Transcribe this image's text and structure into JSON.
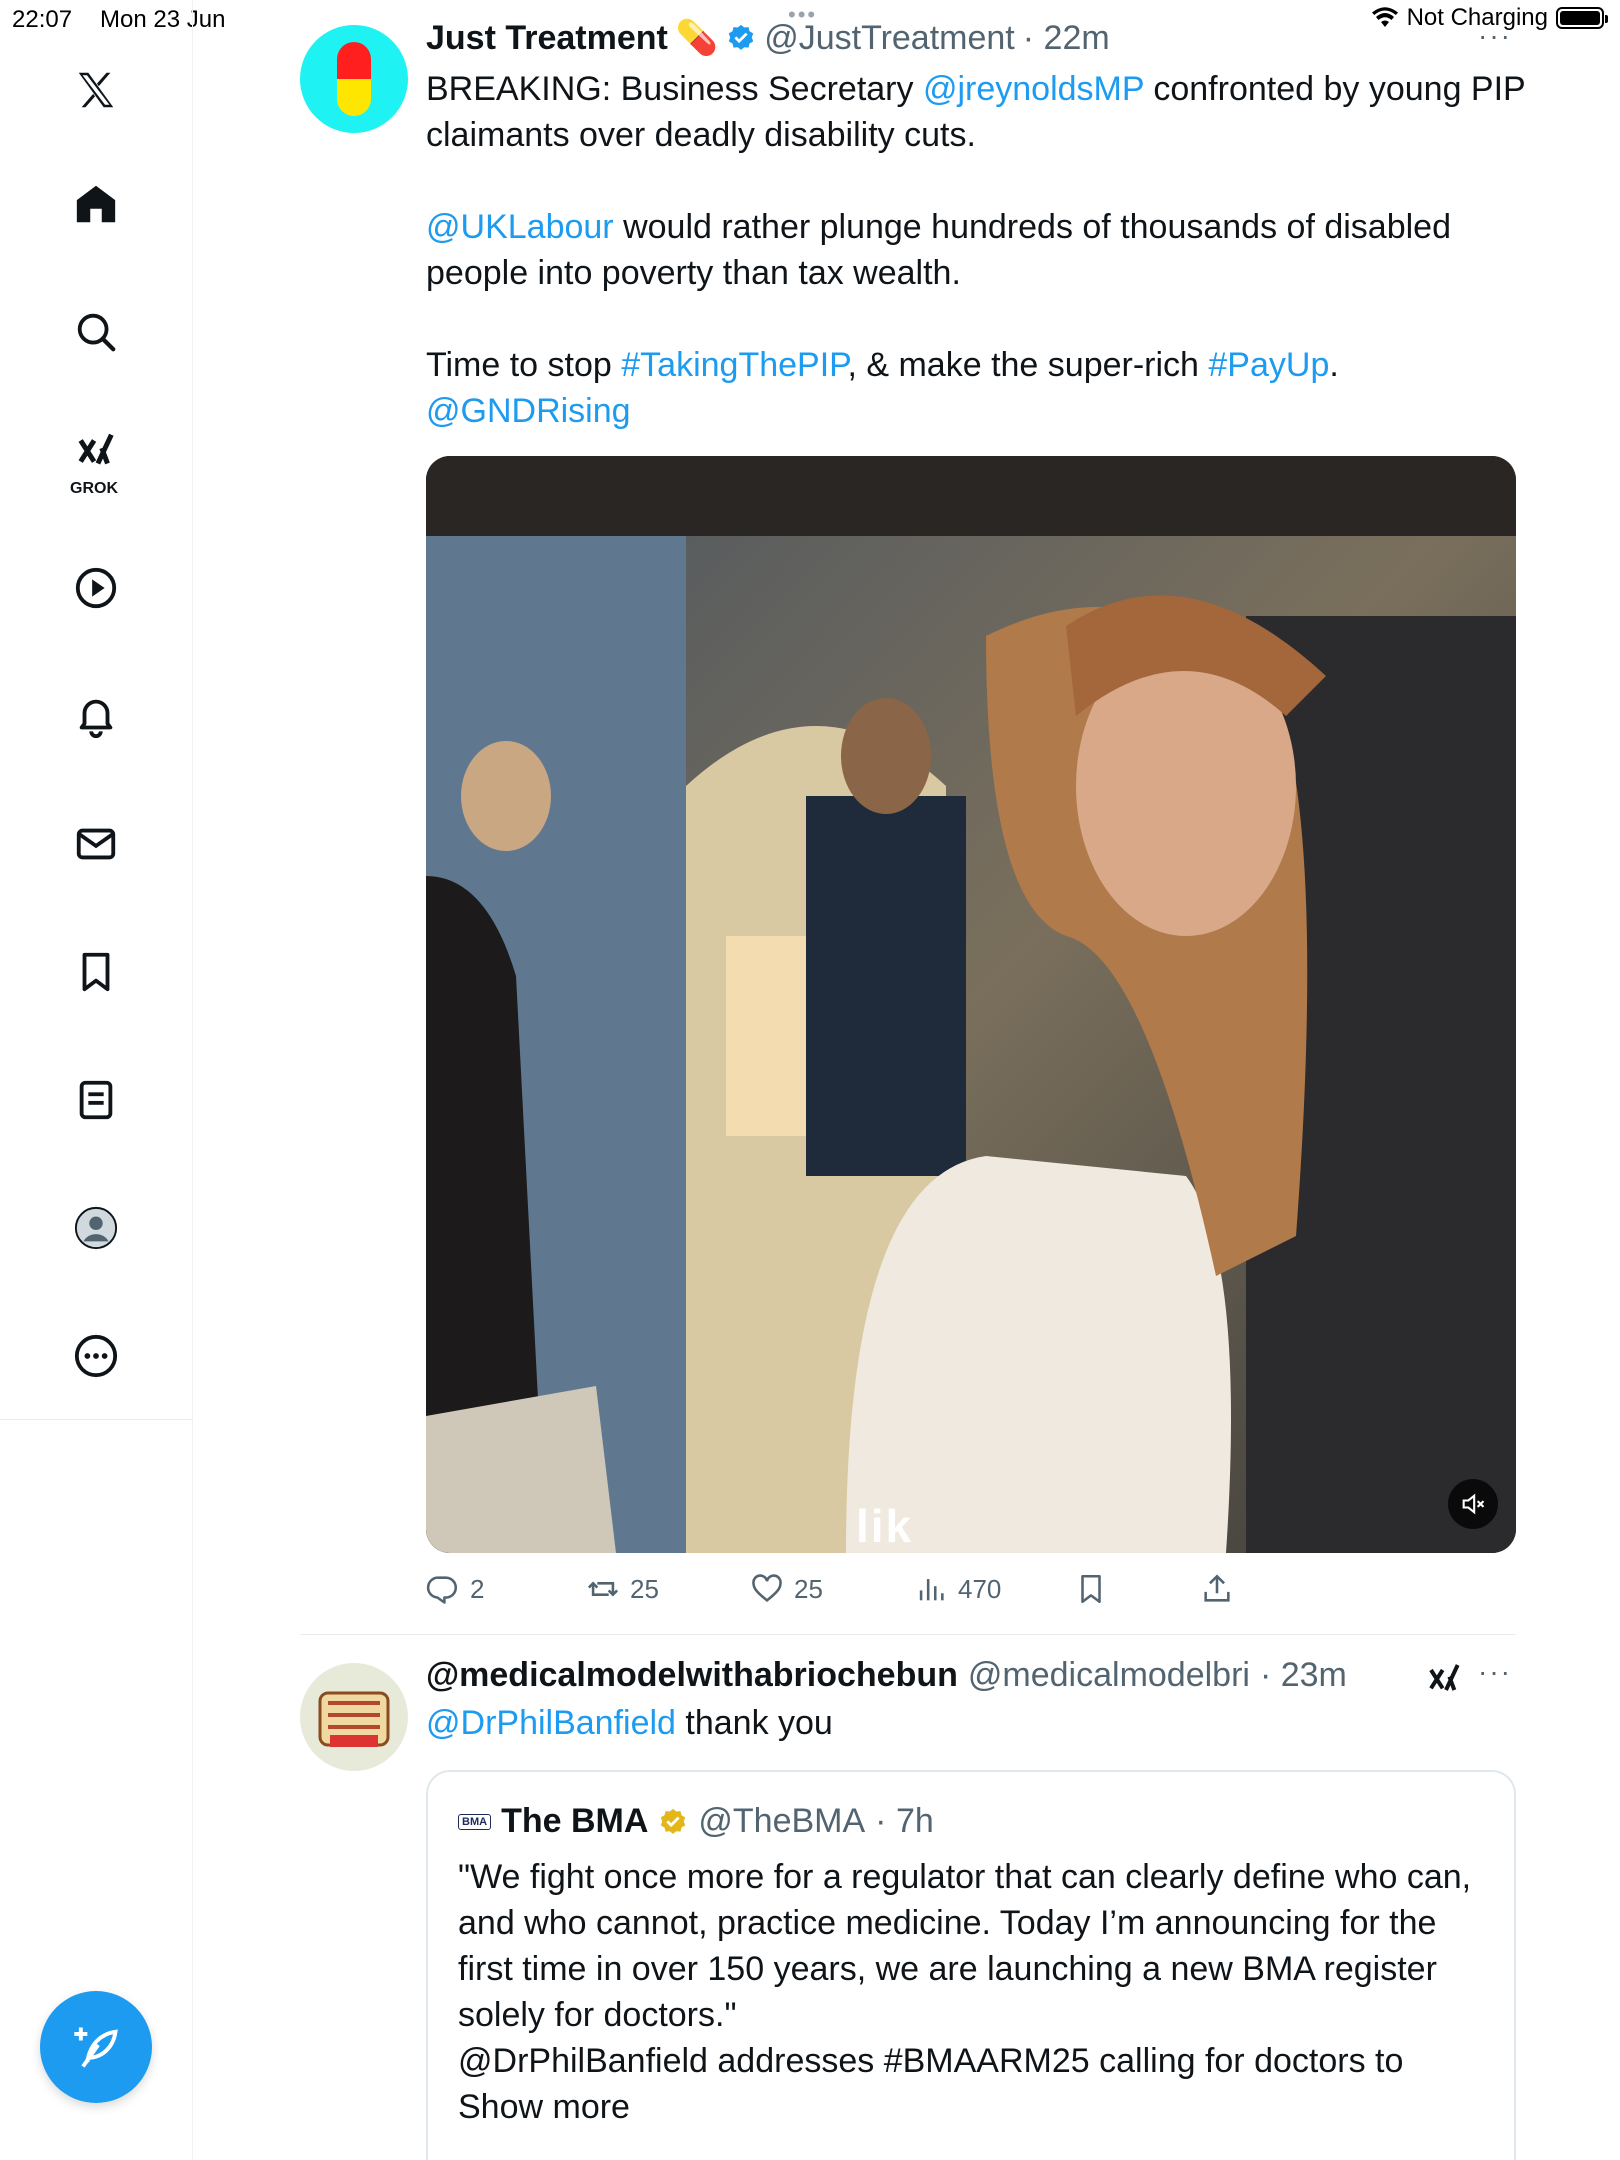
{
  "status_bar": {
    "time": "22:07",
    "date": "Mon 23 Jun",
    "charging": "Not Charging"
  },
  "sidebar": {
    "grok_label": "GROK",
    "items": [
      "x-logo",
      "home",
      "search",
      "grok",
      "video",
      "notifications",
      "messages",
      "bookmarks",
      "lists",
      "profile",
      "more"
    ]
  },
  "tweet1": {
    "name": "Just Treatment",
    "emoji": "💊",
    "handle": "@JustTreatment",
    "time": "· 22m",
    "lines": {
      "p1_a": "BREAKING: Business Secretary ",
      "p1_link": "@jreynoldsMP",
      "p1_b": "  confronted by young PIP claimants over deadly disability cuts.",
      "p2_link": "@UKLabour",
      "p2_b": " would rather plunge hundreds of thousands of disabled people into poverty than tax wealth.",
      "p3_a": "Time to stop ",
      "p3_tag1": "#TakingThePIP",
      "p3_b": ", & make the super-rich ",
      "p3_tag2": "#PayUp",
      "p3_c": ".",
      "p3_link": "@GNDRising"
    },
    "video_caption": "lik",
    "stats": {
      "replies": "2",
      "reposts": "25",
      "likes": "25",
      "views": "470"
    }
  },
  "tweet2": {
    "name": "@medicalmodelwithabriochebun",
    "handle": "@medicalmodelbri",
    "time": "· 23m",
    "text_link": "@DrPhilBanfield",
    "text_rest": " thank you",
    "quote": {
      "logo": "BMA",
      "name": "The BMA",
      "handle": "@TheBMA",
      "time": "· 7h",
      "body": "\"We fight once more for a regulator that can clearly define who can, and who cannot, practice medicine. Today I’m announcing for the first time in over 150 years, we are launching a new BMA register solely for doctors.\"",
      "body2": "@DrPhilBanfield addresses #BMAARM25 calling for doctors to Show more"
    }
  },
  "colors": {
    "accent": "#1d9bf0",
    "text": "#0f1419",
    "muted": "#536471"
  }
}
